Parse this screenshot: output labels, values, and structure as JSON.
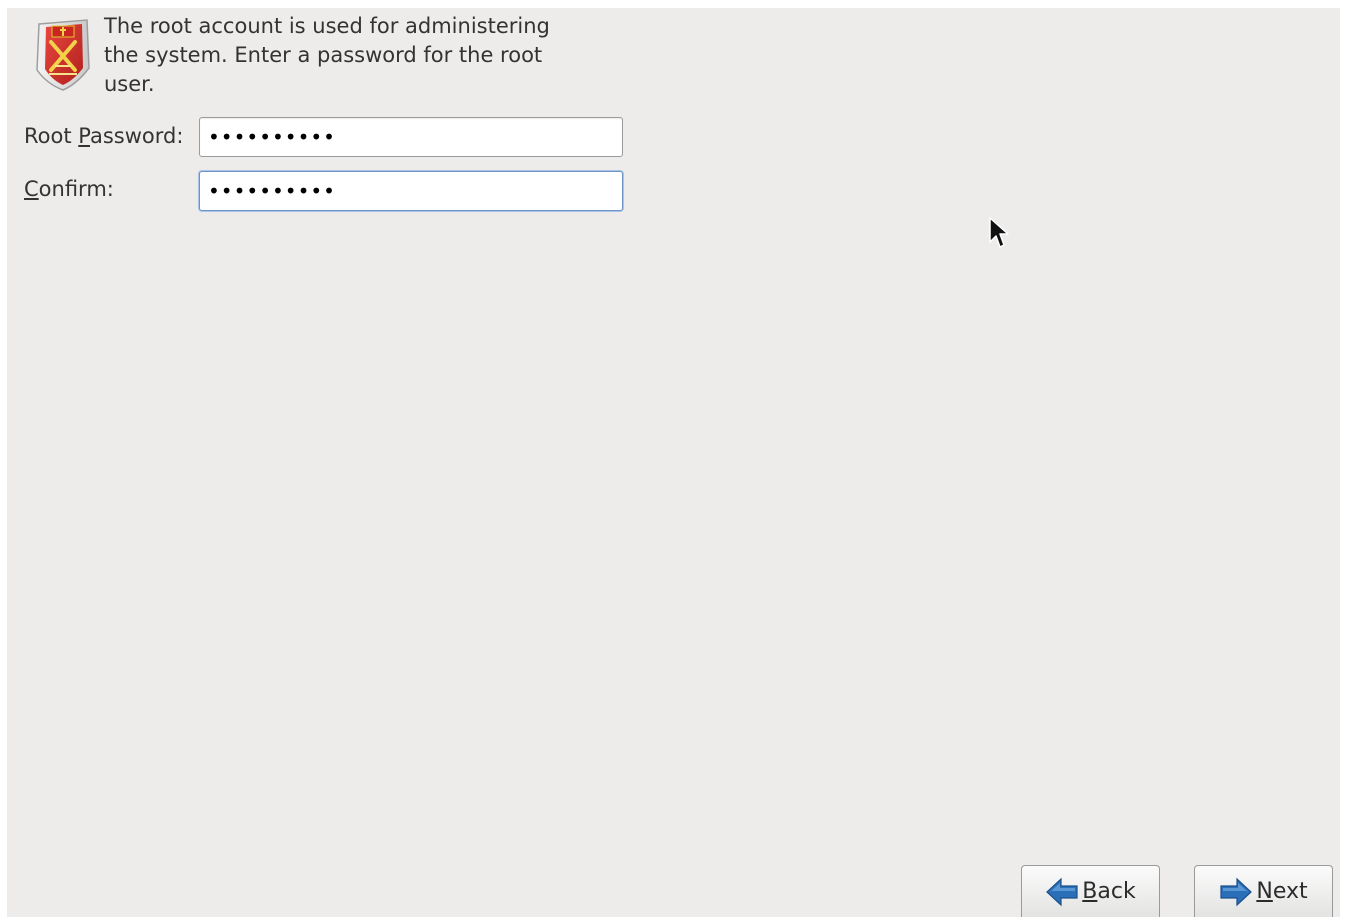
{
  "intro_text": "The root account is used for administering\nthe system.  Enter a password for the root\nuser.",
  "fields": {
    "root_password": {
      "label_before": "Root ",
      "label_mnemonic": "P",
      "label_after": "assword:",
      "value": "••••••••••"
    },
    "confirm": {
      "label_before": "",
      "label_mnemonic": "C",
      "label_after": "onfirm:",
      "value": "••••••••••"
    }
  },
  "buttons": {
    "back": {
      "mnemonic": "B",
      "rest": "ack",
      "icon": "arrow-left-icon"
    },
    "next": {
      "mnemonic": "N",
      "rest": "ext",
      "icon": "arrow-right-icon"
    }
  },
  "icons": {
    "shield": "shield-crest-icon",
    "cursor": "mouse-pointer-icon"
  },
  "colors": {
    "background": "#edeceb",
    "shield_red": "#d8302b",
    "shield_gold": "#e8c531",
    "arrow_blue": "#2b6fb8",
    "focus_border": "#6f95c8"
  }
}
